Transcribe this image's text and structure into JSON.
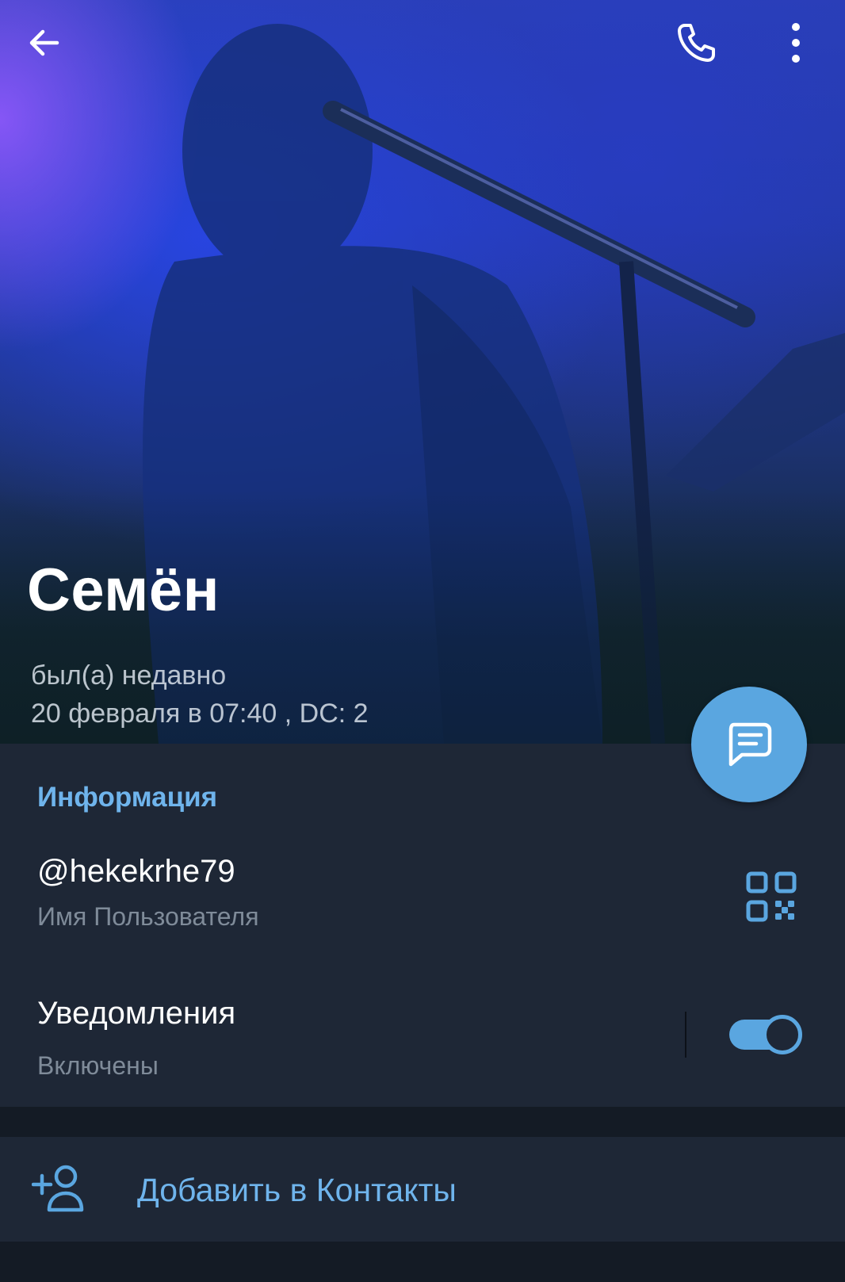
{
  "profile": {
    "name": "Семён",
    "last_seen": "был(а) недавно",
    "details": "20 февраля в 07:40 , DC: 2"
  },
  "header": {
    "back_icon": "arrow-left-icon",
    "call_icon": "phone-icon",
    "more_icon": "more-vertical-icon"
  },
  "info": {
    "section_title": "Информация",
    "username": "@hekekrhe79",
    "username_caption": "Имя Пользователя",
    "qr_icon": "qr-code-icon",
    "notifications_label": "Уведомления",
    "notifications_status": "Включены",
    "notifications_enabled": true
  },
  "actions": {
    "add_contact_label": "Добавить в Контакты",
    "add_contact_icon": "add-user-icon",
    "message_icon": "message-icon"
  },
  "colors": {
    "accent": "#5aa6e0",
    "section_title": "#6fb4ec",
    "background": "#1e2736"
  }
}
